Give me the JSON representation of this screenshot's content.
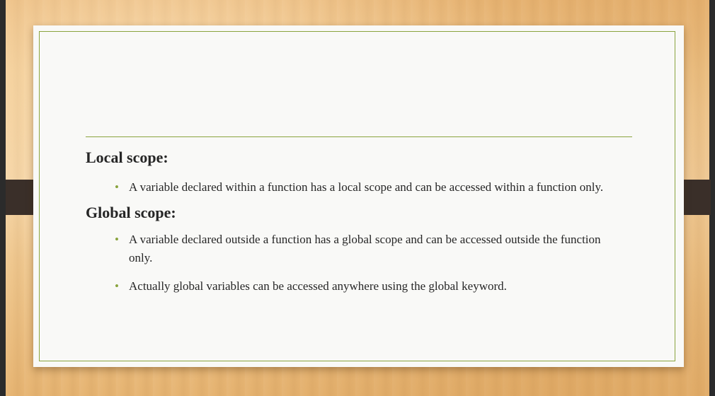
{
  "slide": {
    "local_heading": "Local scope:",
    "local_bullets": [
      "A variable declared within a function has a local scope and can be accessed within a function only."
    ],
    "global_heading": "Global scope:",
    "global_bullets": [
      "A variable declared outside a function has a global scope and can be accessed outside the function only.",
      "Actually global variables can be accessed anywhere using the global keyword."
    ],
    "bullet_icon": "bullet-dot-icon",
    "bullet_symbol": "•"
  },
  "colors": {
    "accent": "#8aa43e",
    "text": "#262626",
    "tab": "#3a2f29",
    "slide_background": "#f9f9f7"
  }
}
